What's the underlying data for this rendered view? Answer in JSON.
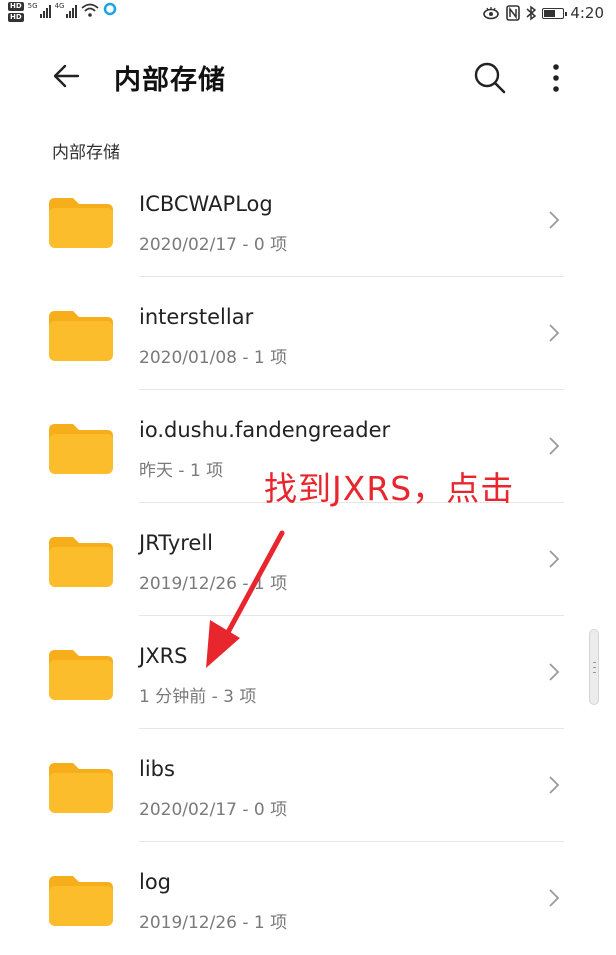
{
  "status_bar": {
    "time": "4:20",
    "network_1": "5G",
    "network_2": "4G",
    "hd_1": "HD",
    "hd_2": "HD",
    "battery_level": 0.6
  },
  "app_bar": {
    "title": "内部存储"
  },
  "breadcrumb": "内部存储",
  "folders": [
    {
      "name": "ICBCWAPLog",
      "meta": "2020/02/17 - 0 项"
    },
    {
      "name": "interstellar",
      "meta": "2020/01/08 - 1 项"
    },
    {
      "name": "io.dushu.fandengreader",
      "meta": "昨天 - 1 项"
    },
    {
      "name": "JRTyrell",
      "meta": "2019/12/26 - 1 项"
    },
    {
      "name": "JXRS",
      "meta": "1 分钟前 - 3 项"
    },
    {
      "name": "libs",
      "meta": "2020/02/17 - 0 项"
    },
    {
      "name": "log",
      "meta": "2019/12/26 - 1 项"
    }
  ],
  "annotation": "找到JXRS，点击",
  "colors": {
    "folder": "#FBBD2C",
    "folder_tab": "#F6AE1B",
    "annotation": "#E8262D"
  }
}
